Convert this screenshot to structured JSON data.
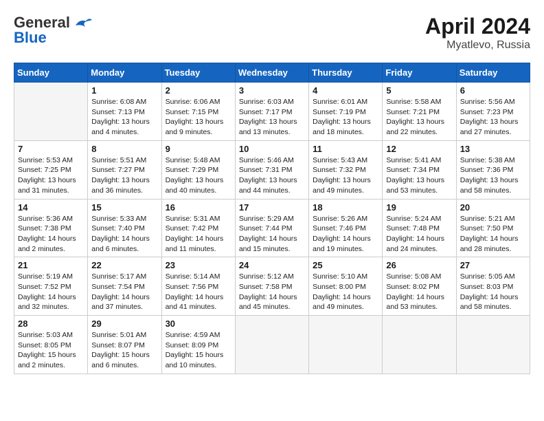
{
  "header": {
    "logo_general": "General",
    "logo_blue": "Blue",
    "title": "April 2024",
    "subtitle": "Myatlevo, Russia"
  },
  "days_of_week": [
    "Sunday",
    "Monday",
    "Tuesday",
    "Wednesday",
    "Thursday",
    "Friday",
    "Saturday"
  ],
  "weeks": [
    [
      {
        "day": "",
        "info": ""
      },
      {
        "day": "1",
        "info": "Sunrise: 6:08 AM\nSunset: 7:13 PM\nDaylight: 13 hours\nand 4 minutes."
      },
      {
        "day": "2",
        "info": "Sunrise: 6:06 AM\nSunset: 7:15 PM\nDaylight: 13 hours\nand 9 minutes."
      },
      {
        "day": "3",
        "info": "Sunrise: 6:03 AM\nSunset: 7:17 PM\nDaylight: 13 hours\nand 13 minutes."
      },
      {
        "day": "4",
        "info": "Sunrise: 6:01 AM\nSunset: 7:19 PM\nDaylight: 13 hours\nand 18 minutes."
      },
      {
        "day": "5",
        "info": "Sunrise: 5:58 AM\nSunset: 7:21 PM\nDaylight: 13 hours\nand 22 minutes."
      },
      {
        "day": "6",
        "info": "Sunrise: 5:56 AM\nSunset: 7:23 PM\nDaylight: 13 hours\nand 27 minutes."
      }
    ],
    [
      {
        "day": "7",
        "info": "Sunrise: 5:53 AM\nSunset: 7:25 PM\nDaylight: 13 hours\nand 31 minutes."
      },
      {
        "day": "8",
        "info": "Sunrise: 5:51 AM\nSunset: 7:27 PM\nDaylight: 13 hours\nand 36 minutes."
      },
      {
        "day": "9",
        "info": "Sunrise: 5:48 AM\nSunset: 7:29 PM\nDaylight: 13 hours\nand 40 minutes."
      },
      {
        "day": "10",
        "info": "Sunrise: 5:46 AM\nSunset: 7:31 PM\nDaylight: 13 hours\nand 44 minutes."
      },
      {
        "day": "11",
        "info": "Sunrise: 5:43 AM\nSunset: 7:32 PM\nDaylight: 13 hours\nand 49 minutes."
      },
      {
        "day": "12",
        "info": "Sunrise: 5:41 AM\nSunset: 7:34 PM\nDaylight: 13 hours\nand 53 minutes."
      },
      {
        "day": "13",
        "info": "Sunrise: 5:38 AM\nSunset: 7:36 PM\nDaylight: 13 hours\nand 58 minutes."
      }
    ],
    [
      {
        "day": "14",
        "info": "Sunrise: 5:36 AM\nSunset: 7:38 PM\nDaylight: 14 hours\nand 2 minutes."
      },
      {
        "day": "15",
        "info": "Sunrise: 5:33 AM\nSunset: 7:40 PM\nDaylight: 14 hours\nand 6 minutes."
      },
      {
        "day": "16",
        "info": "Sunrise: 5:31 AM\nSunset: 7:42 PM\nDaylight: 14 hours\nand 11 minutes."
      },
      {
        "day": "17",
        "info": "Sunrise: 5:29 AM\nSunset: 7:44 PM\nDaylight: 14 hours\nand 15 minutes."
      },
      {
        "day": "18",
        "info": "Sunrise: 5:26 AM\nSunset: 7:46 PM\nDaylight: 14 hours\nand 19 minutes."
      },
      {
        "day": "19",
        "info": "Sunrise: 5:24 AM\nSunset: 7:48 PM\nDaylight: 14 hours\nand 24 minutes."
      },
      {
        "day": "20",
        "info": "Sunrise: 5:21 AM\nSunset: 7:50 PM\nDaylight: 14 hours\nand 28 minutes."
      }
    ],
    [
      {
        "day": "21",
        "info": "Sunrise: 5:19 AM\nSunset: 7:52 PM\nDaylight: 14 hours\nand 32 minutes."
      },
      {
        "day": "22",
        "info": "Sunrise: 5:17 AM\nSunset: 7:54 PM\nDaylight: 14 hours\nand 37 minutes."
      },
      {
        "day": "23",
        "info": "Sunrise: 5:14 AM\nSunset: 7:56 PM\nDaylight: 14 hours\nand 41 minutes."
      },
      {
        "day": "24",
        "info": "Sunrise: 5:12 AM\nSunset: 7:58 PM\nDaylight: 14 hours\nand 45 minutes."
      },
      {
        "day": "25",
        "info": "Sunrise: 5:10 AM\nSunset: 8:00 PM\nDaylight: 14 hours\nand 49 minutes."
      },
      {
        "day": "26",
        "info": "Sunrise: 5:08 AM\nSunset: 8:02 PM\nDaylight: 14 hours\nand 53 minutes."
      },
      {
        "day": "27",
        "info": "Sunrise: 5:05 AM\nSunset: 8:03 PM\nDaylight: 14 hours\nand 58 minutes."
      }
    ],
    [
      {
        "day": "28",
        "info": "Sunrise: 5:03 AM\nSunset: 8:05 PM\nDaylight: 15 hours\nand 2 minutes."
      },
      {
        "day": "29",
        "info": "Sunrise: 5:01 AM\nSunset: 8:07 PM\nDaylight: 15 hours\nand 6 minutes."
      },
      {
        "day": "30",
        "info": "Sunrise: 4:59 AM\nSunset: 8:09 PM\nDaylight: 15 hours\nand 10 minutes."
      },
      {
        "day": "",
        "info": ""
      },
      {
        "day": "",
        "info": ""
      },
      {
        "day": "",
        "info": ""
      },
      {
        "day": "",
        "info": ""
      }
    ]
  ]
}
